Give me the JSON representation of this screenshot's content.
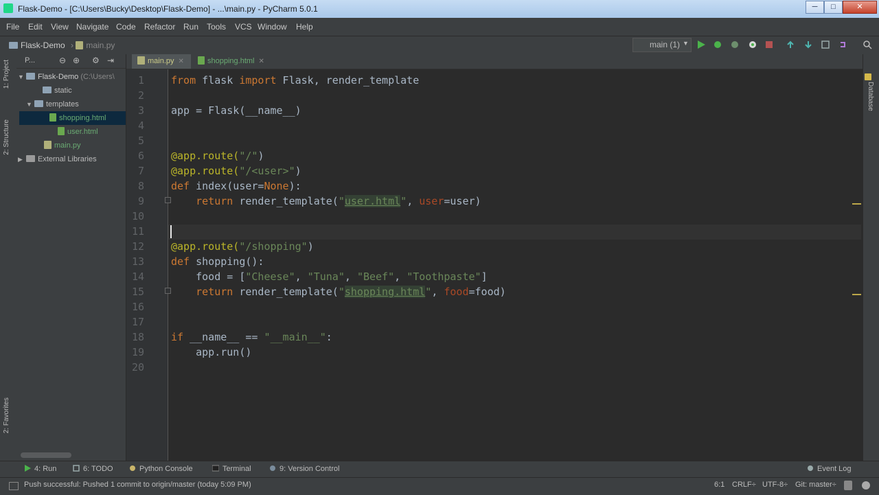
{
  "window": {
    "title": "Flask-Demo - [C:\\Users\\Bucky\\Desktop\\Flask-Demo] - ...\\main.py - PyCharm 5.0.1",
    "minimize": "─",
    "maximize": "□",
    "close": "✕"
  },
  "menu": [
    "File",
    "Edit",
    "View",
    "Navigate",
    "Code",
    "Refactor",
    "Run",
    "Tools",
    "VCS",
    "Window",
    "Help"
  ],
  "breadcrumb": {
    "project": "Flask-Demo",
    "file": "main.py"
  },
  "toolbar": {
    "run_config": "main (1)"
  },
  "side_tabs": {
    "project": "1: Project",
    "structure": "2: Structure",
    "favorites": "2: Favorites",
    "database": "Database"
  },
  "project_panel": {
    "toolbar_label": "P...",
    "tree": [
      {
        "label": "Flask-Demo",
        "suffix": "(C:\\Users\\",
        "type": "folder"
      },
      {
        "label": "static",
        "type": "folder"
      },
      {
        "label": "templates",
        "type": "folder"
      },
      {
        "label": "shopping.html",
        "type": "html"
      },
      {
        "label": "user.html",
        "type": "html"
      },
      {
        "label": "main.py",
        "type": "py"
      },
      {
        "label": "External Libraries",
        "type": "lib"
      }
    ]
  },
  "tabs": [
    {
      "label": "main.py",
      "active": true
    },
    {
      "label": "shopping.html",
      "active": false
    }
  ],
  "editor": {
    "line_numbers": [
      "1",
      "2",
      "3",
      "4",
      "5",
      "6",
      "7",
      "8",
      "9",
      "10",
      "11",
      "12",
      "13",
      "14",
      "15",
      "16",
      "17",
      "18",
      "19",
      "20"
    ],
    "code": {
      "l1_kw1": "from",
      "l1_mod": " flask ",
      "l1_kw2": "import",
      "l1_rest": " Flask, render_template",
      "l3": "app = Flask(__name__)",
      "l6_dec": "@app.route(",
      "l6_str": "\"/\"",
      "l6_end": ")",
      "l7_dec": "@app.route(",
      "l7_str": "\"/<user>\"",
      "l7_end": ")",
      "l8_kw": "def",
      "l8_name": " index(user=",
      "l8_none": "None",
      "l8_end": "):",
      "l9_kw": "    return",
      "l9_fn": " render_template(",
      "l9_q1": "\"",
      "l9_file": "user.html",
      "l9_q2": "\"",
      "l9_comma": ", ",
      "l9_param": "user",
      "l9_rest": "=user)",
      "l12_dec": "@app.route(",
      "l12_str": "\"/shopping\"",
      "l12_end": ")",
      "l13_kw": "def",
      "l13_name": " shopping():",
      "l14_a": "    food = [",
      "l14_s1": "\"Cheese\"",
      "l14_c1": ", ",
      "l14_s2": "\"Tuna\"",
      "l14_c2": ", ",
      "l14_s3": "\"Beef\"",
      "l14_c3": ", ",
      "l14_s4": "\"Toothpaste\"",
      "l14_end": "]",
      "l15_kw": "    return",
      "l15_fn": " render_template(",
      "l15_q1": "\"",
      "l15_file": "shopping.html",
      "l15_q2": "\"",
      "l15_comma": ", ",
      "l15_param": "food",
      "l15_rest": "=food)",
      "l18_kw": "if",
      "l18_mid": " __name__ == ",
      "l18_str": "\"__main__\"",
      "l18_end": ":",
      "l19": "    app.run()"
    }
  },
  "bottom_tools": [
    {
      "label": "4: Run"
    },
    {
      "label": "6: TODO"
    },
    {
      "label": "Python Console"
    },
    {
      "label": "Terminal"
    },
    {
      "label": "9: Version Control"
    }
  ],
  "event_log": "Event Log",
  "status": {
    "message": "Push successful: Pushed 1 commit to origin/master (today 5:09 PM)",
    "position": "6:1",
    "line_sep": "CRLF÷",
    "encoding": "UTF-8÷",
    "git": "Git: master÷"
  },
  "colors": {
    "editor_bg": "#2b2b2b",
    "keyword": "#cc7832",
    "string": "#6a8759",
    "decorator": "#bbb529",
    "param": "#aa4926"
  }
}
